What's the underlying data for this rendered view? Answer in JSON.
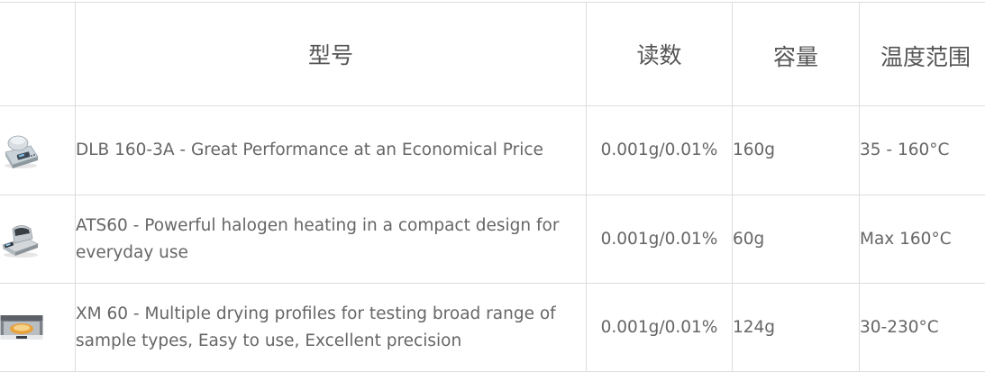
{
  "table": {
    "headers": {
      "model": "型号",
      "readability": "读数",
      "capacity": "容量",
      "temperature_range": "温度范围"
    },
    "rows": [
      {
        "image_icon": "moisture-analyzer-dlb-icon",
        "model": "DLB 160-3A - Great Performance at an Economical Price",
        "readability": "0.001g/0.01%",
        "capacity": "160g",
        "temperature_range": "35 - 160°C"
      },
      {
        "image_icon": "moisture-analyzer-ats-icon",
        "model": "ATS60 - Powerful halogen heating in a compact design for everyday use",
        "readability": "0.001g/0.01%",
        "capacity": "60g",
        "temperature_range": "Max 160°C"
      },
      {
        "image_icon": "moisture-analyzer-xm-icon",
        "model": "XM 60 - Multiple drying profiles for testing broad range of sample types, Easy to use, Excellent precision",
        "readability": "0.001g/0.01%",
        "capacity": "124g",
        "temperature_range": "30-230°C"
      }
    ]
  },
  "colors": {
    "border": "#dddddd",
    "text": "#666666",
    "header_text": "#555555",
    "background": "#ffffff"
  }
}
